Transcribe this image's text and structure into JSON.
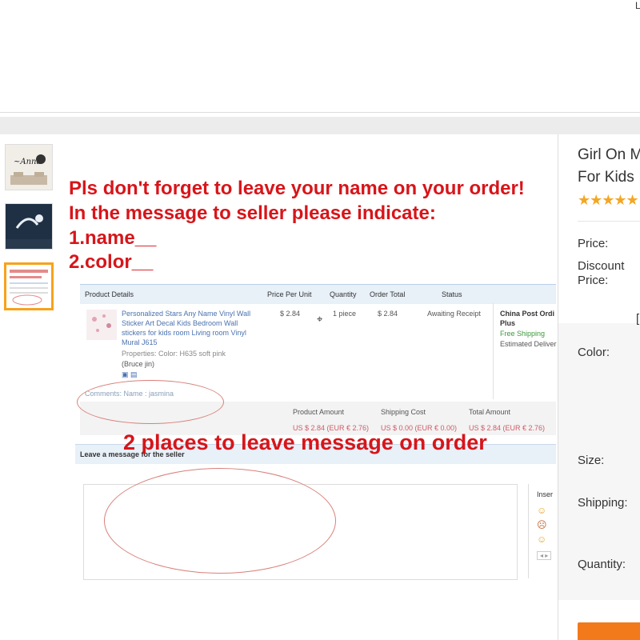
{
  "header": {
    "corner_char": "L"
  },
  "thumbnails": [
    {
      "name": "thumbnail-1",
      "selected": false
    },
    {
      "name": "thumbnail-2",
      "selected": false
    },
    {
      "name": "thumbnail-3",
      "selected": true
    }
  ],
  "main_image": {
    "red_lines": [
      "Pls don't forget to leave your name on your order!",
      "In the message to seller please indicate:",
      "1.name__",
      "2.color__"
    ],
    "order_table": {
      "headers": [
        "Product Details",
        "Price Per Unit",
        "Quantity",
        "Order Total",
        "Status"
      ],
      "product_lines": [
        "Personalized Stars Any Name Vinyl Wall",
        "Sticker Art Decal Kids Bedroom Wall",
        "stickers for kids room Living room Vinyl",
        "Mural J615"
      ],
      "properties": "Properties: Color: H635 soft pink",
      "buyer": "(Bruce jin)",
      "price": "$ 2.84",
      "quantity": "1 piece",
      "order_total": "$ 2.84",
      "status": "Awaiting Receipt",
      "shipping_lines": [
        "China Post Ordi",
        "Plus",
        "Free Shipping",
        "Estimated Deliver"
      ],
      "comments": "Comments: Name : jasmina",
      "summary_headers": [
        "Product Amount",
        "Shipping Cost",
        "Total Amount"
      ],
      "summary_values": [
        "US $ 2.84 (EUR € 2.76)",
        "US $ 0.00 (EUR € 0.00)",
        "US $ 2.84 (EUR € 2.76)"
      ],
      "message_header": "Leave a message for the seller",
      "insert_label": "Inser"
    },
    "banner": "2 places to leave message on order"
  },
  "product": {
    "title_line1": "Girl On M",
    "title_line2": "For Kids",
    "stars": "★★★★★",
    "rating_fraction": 1.0,
    "labels": {
      "price": "Price:",
      "discount_1": "Discount",
      "discount_2": "Price:",
      "bracket": "[",
      "color": "Color:",
      "size": "Size:",
      "shipping": "Shipping:",
      "quantity": "Quantity:"
    }
  },
  "colors": {
    "accent_orange": "#f27a1a",
    "thumb_selected": "#f7a21b",
    "star": "#f5a623",
    "red_text": "#d7151a"
  }
}
